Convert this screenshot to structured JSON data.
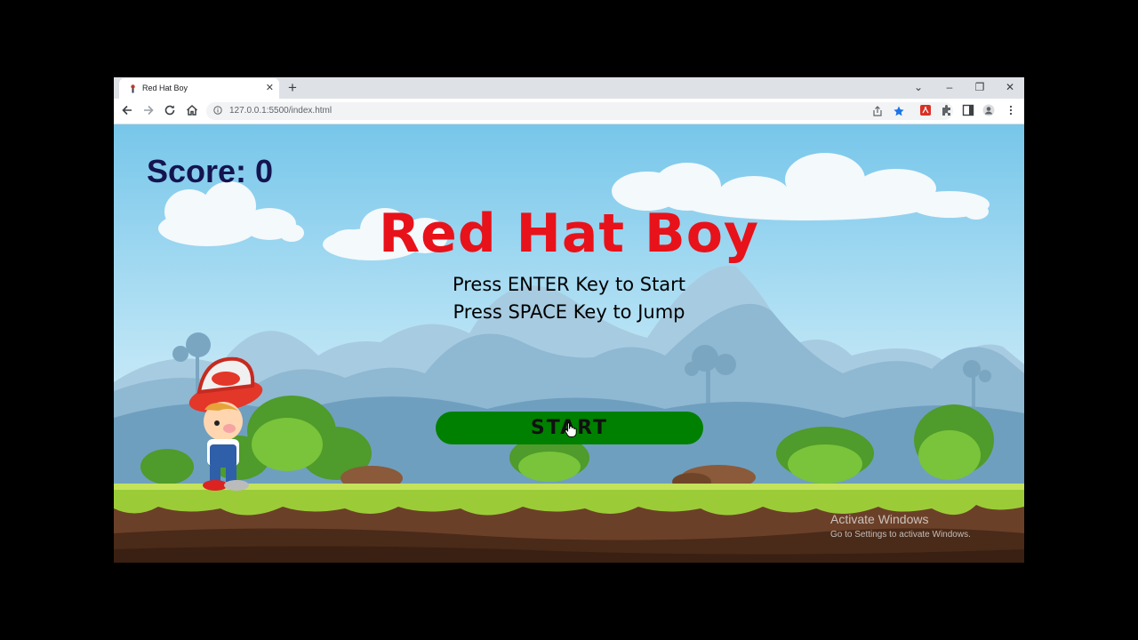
{
  "browser": {
    "tab_title": "Red Hat Boy",
    "url": "127.0.0.1:5500/index.html",
    "new_tab_symbol": "+",
    "tab_close_symbol": "✕",
    "window_controls": {
      "dropdown": "⌄",
      "minimize": "–",
      "restore": "❐",
      "close": "✕"
    },
    "icons": [
      "back-icon",
      "forward-icon",
      "reload-icon",
      "home-icon",
      "info-icon",
      "share-icon",
      "bookmark-star-icon",
      "pdf-extension-icon",
      "extensions-icon",
      "side-panel-icon",
      "profile-icon",
      "menu-icon"
    ],
    "colors": {
      "tabstrip": "#dee1e6",
      "star": "#1a73e8",
      "pdf": "#d93025"
    }
  },
  "game": {
    "score_label": "Score: 0",
    "title": "Red Hat Boy",
    "instructions": [
      "Press ENTER Key to Start",
      "Press SPACE Key to Jump"
    ],
    "start_label": "START",
    "colors": {
      "title": "#e8121a",
      "score": "#141450",
      "start_button": "#008000",
      "sky": "#8fd3ef",
      "grass": "#a8d43a",
      "dirt": "#6b4028"
    }
  },
  "os_watermark": {
    "line1": "Activate Windows",
    "line2": "Go to Settings to activate Windows."
  }
}
